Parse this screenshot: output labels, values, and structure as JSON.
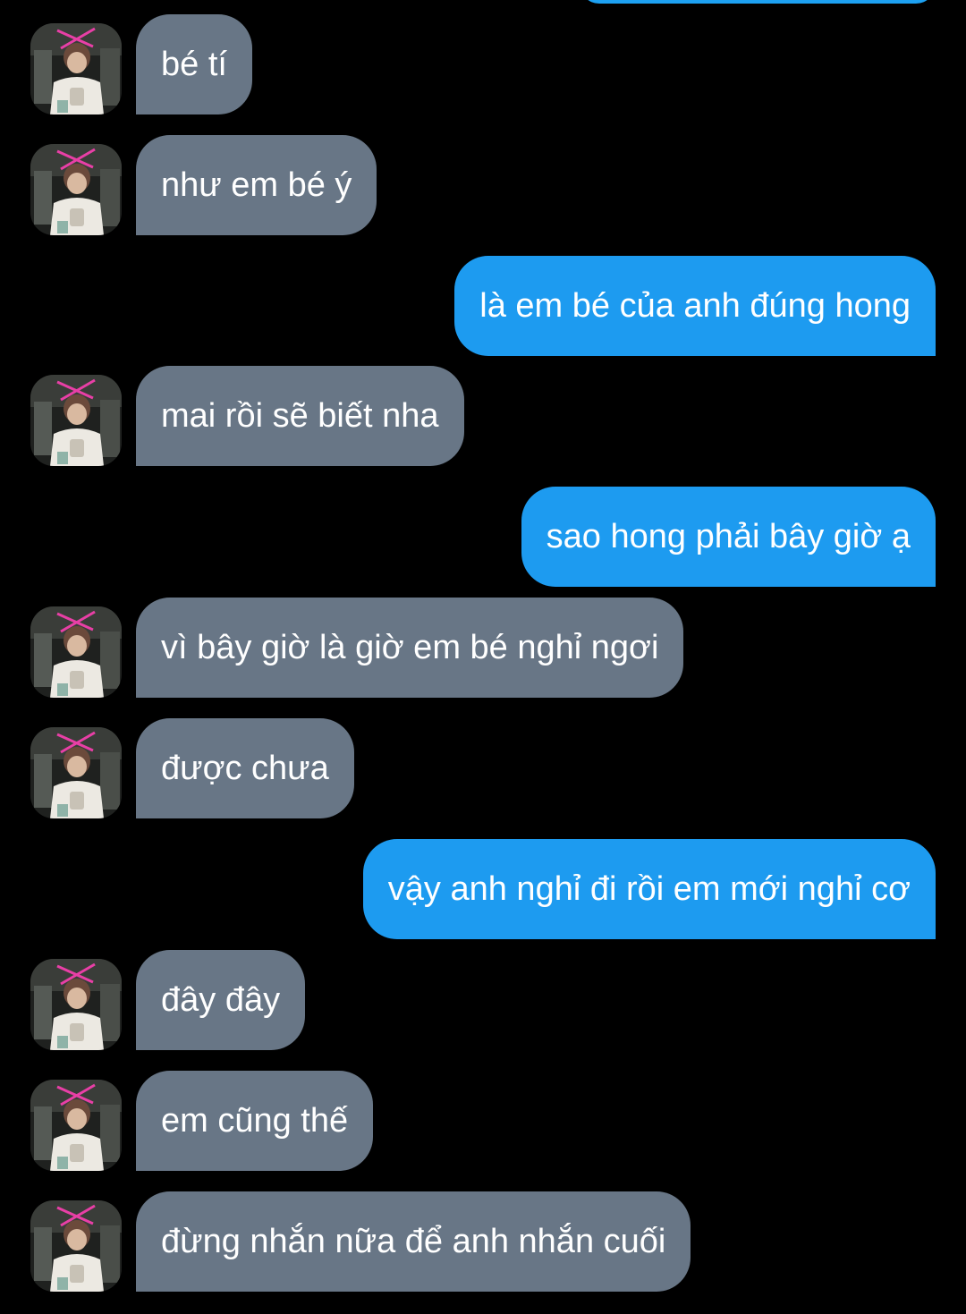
{
  "conversation": {
    "messages": [
      {
        "sender": "them",
        "text": "bé tí"
      },
      {
        "sender": "them",
        "text": "như em bé ý"
      },
      {
        "sender": "me",
        "text": "là em bé của anh đúng hong"
      },
      {
        "sender": "them",
        "text": "mai rồi sẽ biết nha"
      },
      {
        "sender": "me",
        "text": "sao hong phải bây giờ ạ"
      },
      {
        "sender": "them",
        "text": "vì bây giờ là giờ em bé nghỉ ngơi"
      },
      {
        "sender": "them",
        "text": "được chưa"
      },
      {
        "sender": "me",
        "text": "vậy anh nghỉ đi rồi em mới nghỉ cơ"
      },
      {
        "sender": "them",
        "text": "đây đây"
      },
      {
        "sender": "them",
        "text": "em cũng thế"
      },
      {
        "sender": "them",
        "text": "đừng nhắn nữa để anh nhắn cuối"
      }
    ]
  },
  "colors": {
    "background": "#000000",
    "received_bubble": "#687686",
    "sent_bubble": "#1d9bf0",
    "text": "#ffffff"
  },
  "icons": {
    "contact_avatar": "avatar-photo-icon"
  }
}
